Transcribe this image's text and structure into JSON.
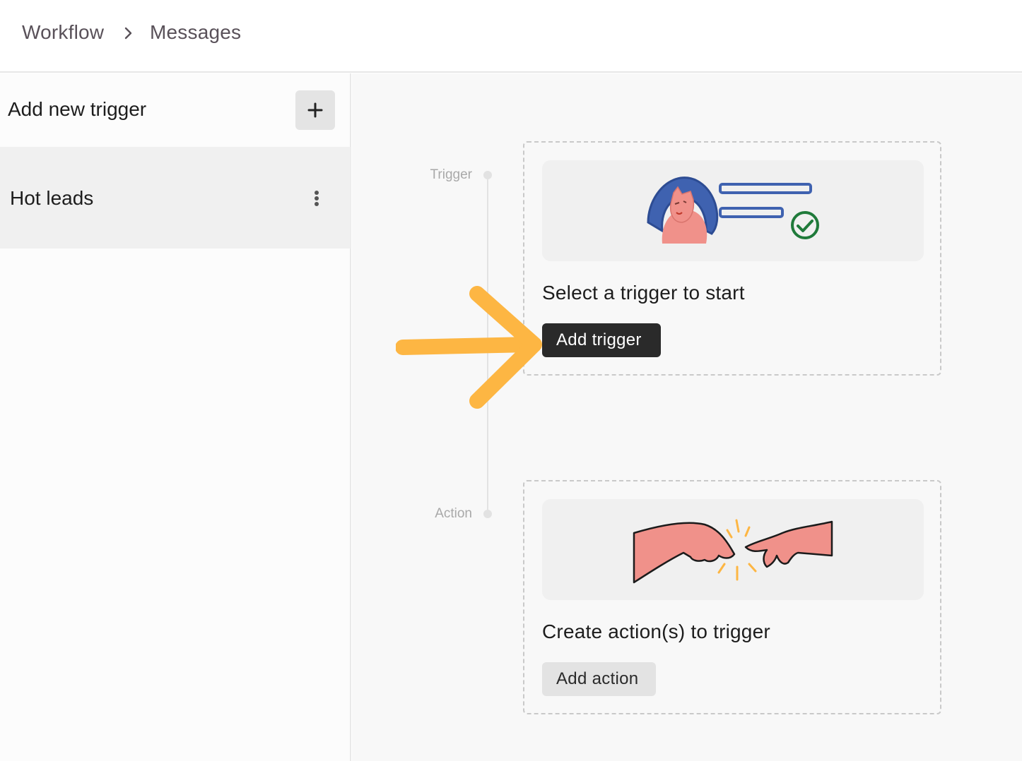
{
  "breadcrumb": {
    "items": [
      "Workflow",
      "Messages"
    ],
    "separator_icon": "chevron-right-icon"
  },
  "sidebar": {
    "header_title": "Add new trigger",
    "add_icon": "plus-icon",
    "items": [
      {
        "label": "Hot leads",
        "menu_icon": "more-vertical-icon",
        "selected": true
      }
    ]
  },
  "timeline": {
    "steps": [
      "Trigger",
      "Action"
    ]
  },
  "trigger_card": {
    "title": "Select a trigger to start",
    "button_label": "Add trigger",
    "illustration": "person-with-checklist-illustration"
  },
  "action_card": {
    "title": "Create action(s) to trigger",
    "button_label": "Add action",
    "illustration": "reaching-hands-illustration"
  },
  "annotation": {
    "icon": "pointer-arrow-icon",
    "color": "#FDB643"
  },
  "colors": {
    "primary_button": "#2a2a2a",
    "secondary_button": "#e3e3e3",
    "accent_arrow": "#FDB643",
    "illustration_pink": "#F0918A",
    "illustration_blue": "#3F62B0",
    "illustration_green": "#1F7A3A"
  }
}
